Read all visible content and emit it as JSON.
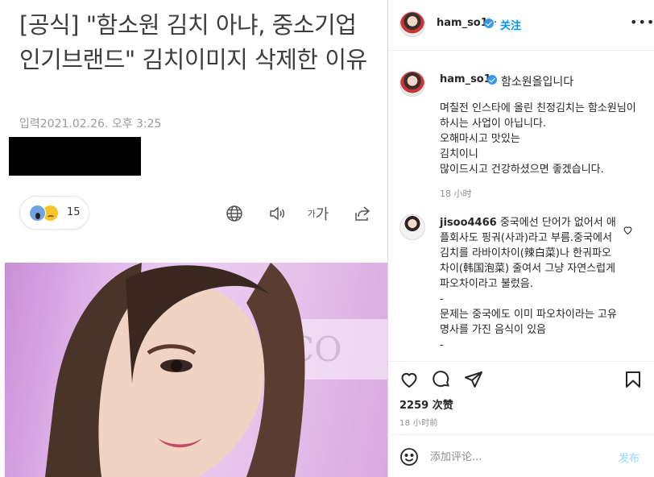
{
  "article": {
    "headline": "[공식] \"함소원 김치 아냐, 중소기업 인기브랜드\" 김치이미지 삭제한 이유",
    "dateline": "입력2021.02.26. 오후 3:25",
    "reaction_count": "15",
    "font_tool_label_small": "가",
    "font_tool_label_large": "가"
  },
  "instagram": {
    "author": "ham_so1",
    "follow_label": "关注",
    "more_label": "•••",
    "caption_head": "함소원올입니다",
    "caption_body": "며칠전 인스타에 올린 친정김치는 함소원님이 하시는 사업이 아닙니다.\n오해마시고 맛있는\n김치이니\n많이드시고 건강하셨으면 좋겠습니다.",
    "caption_time": "18 小时",
    "comment_user": "jisoo4466",
    "comment_body": "중국에선 단어가 없어서 애플회사도 핑궈(사과)라고 부름.중국에서 김치를 라바이차이(辣白菜)나 한궈파오차이(韩国泡菜) 줄여서 그냥 자연스럽게 파오차이라고 불렀음.\n-\n문제는 중국에도 이미 파오차이라는 고유명사를 가진 음식이 있음\n-",
    "likes": "2259 次赞",
    "post_time": "18 小时前",
    "comment_placeholder": "添加评论...",
    "post_label": "发布"
  },
  "colors": {
    "accent": "#0095f6",
    "verified": "#3897f0",
    "post_disabled": "#b2dffc",
    "muted": "#8e8e8e"
  },
  "icons": [
    "globe-icon",
    "speaker-icon",
    "share-icon",
    "heart-icon",
    "comment-icon",
    "send-icon",
    "bookmark-icon",
    "emoji-icon",
    "verified-badge-icon",
    "more-icon"
  ]
}
